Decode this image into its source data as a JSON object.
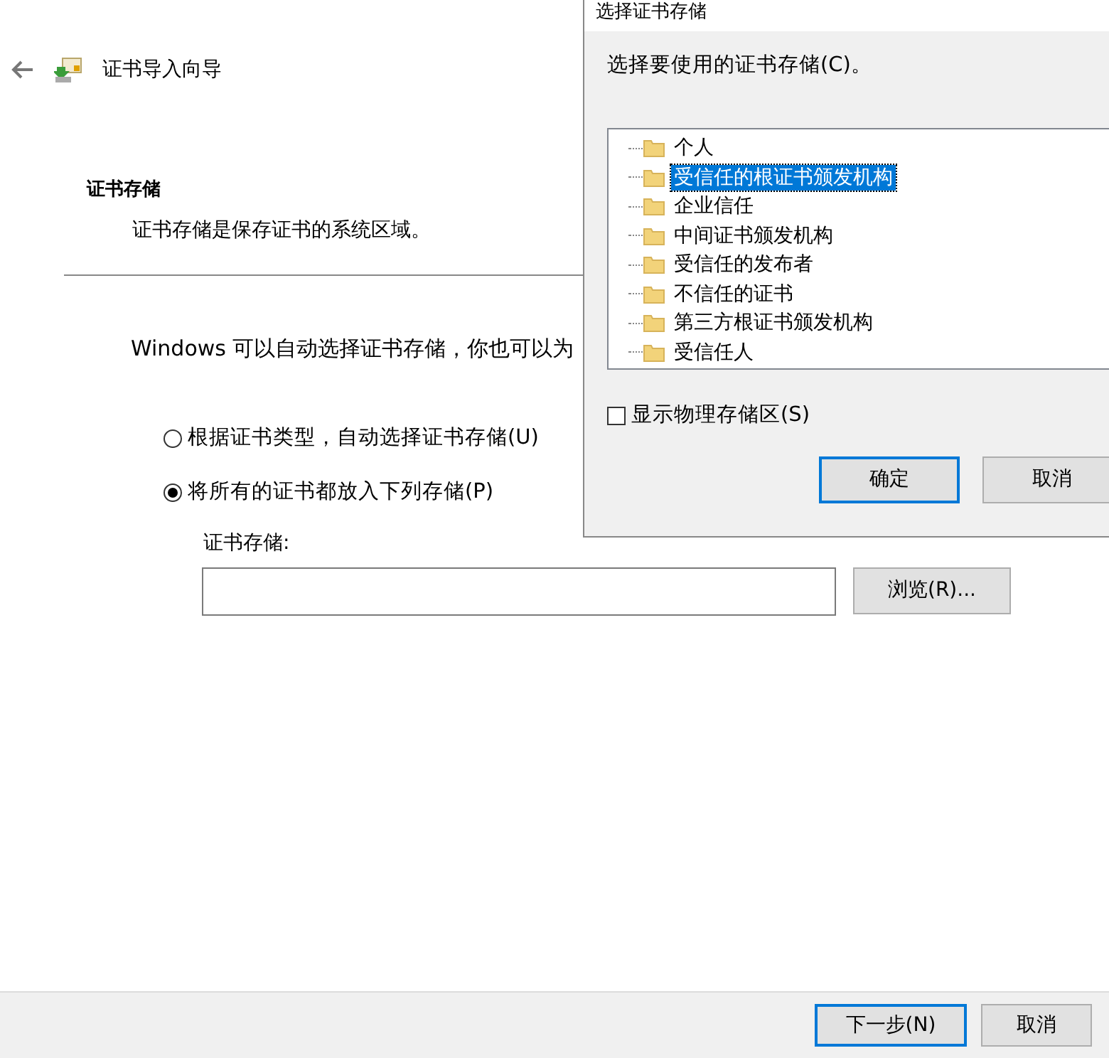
{
  "wizard": {
    "title": "证书导入向导",
    "section_title": "证书存储",
    "section_desc": "证书存储是保存证书的系统区域。",
    "intro": "Windows 可以自动选择证书存储，你也可以为",
    "options": [
      {
        "label": "根据证书类型，自动选择证书存储(U)",
        "selected": false
      },
      {
        "label": "将所有的证书都放入下列存储(P)",
        "selected": true
      }
    ],
    "store_label": "证书存储:",
    "browse_button": "浏览(R)...",
    "footer_buttons": [
      {
        "label": "下一步(N)",
        "kind": "default"
      },
      {
        "label": "取消",
        "kind": "normal"
      }
    ]
  },
  "dialog": {
    "title": "选择证书存储",
    "prompt": "选择要使用的证书存储(C)。",
    "stores": [
      {
        "label": "个人",
        "selected": false
      },
      {
        "label": "受信任的根证书颁发机构",
        "selected": true
      },
      {
        "label": "企业信任",
        "selected": false
      },
      {
        "label": "中间证书颁发机构",
        "selected": false
      },
      {
        "label": "受信任的发布者",
        "selected": false
      },
      {
        "label": "不信任的证书",
        "selected": false
      },
      {
        "label": "第三方根证书颁发机构",
        "selected": false
      },
      {
        "label": "受信任人",
        "selected": false
      }
    ],
    "show_physical": {
      "label": "显示物理存储区(S)",
      "checked": false
    },
    "buttons": [
      {
        "label": "确定",
        "kind": "default"
      },
      {
        "label": "取消",
        "kind": "normal"
      }
    ]
  }
}
